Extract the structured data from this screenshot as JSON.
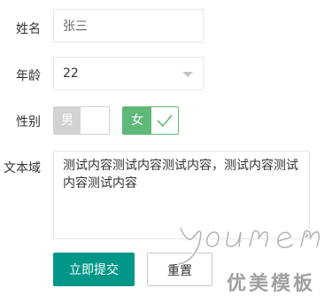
{
  "form": {
    "name": {
      "label": "姓名",
      "value": "张三"
    },
    "age": {
      "label": "年龄",
      "value": "22"
    },
    "gender": {
      "label": "性别",
      "options": [
        {
          "label": "男",
          "selected": false
        },
        {
          "label": "女",
          "selected": true
        }
      ]
    },
    "bio": {
      "label": "文本域",
      "value": "测试内容测试内容测试内容，测试内容测试内容测试内容"
    },
    "buttons": {
      "submit": "立即提交",
      "reset": "重置"
    }
  },
  "colors": {
    "primary": "#009688",
    "radio_selected": "#5fb878",
    "radio_unselected": "#d2d2d2"
  },
  "watermark": {
    "logo_text": "youmei",
    "brand_text": "优美模板"
  }
}
